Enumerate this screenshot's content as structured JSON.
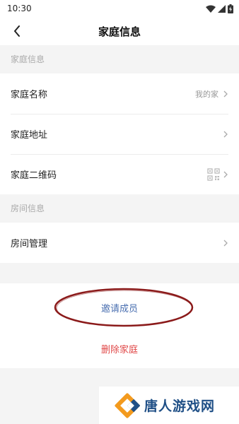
{
  "status_bar": {
    "time": "10:30"
  },
  "header": {
    "title": "家庭信息"
  },
  "sections": [
    {
      "header": "家庭信息",
      "rows": [
        {
          "label": "家庭名称",
          "value": "我的家"
        },
        {
          "label": "家庭地址",
          "value": ""
        },
        {
          "label": "家庭二维码",
          "value": ""
        }
      ]
    },
    {
      "header": "房间信息",
      "rows": [
        {
          "label": "房间管理",
          "value": ""
        }
      ]
    }
  ],
  "actions": {
    "invite": "邀请成员",
    "delete": "删除家庭"
  },
  "watermark": {
    "text": "唐人游戏网"
  },
  "colors": {
    "invite": "#4a6fb0",
    "delete": "#e04848",
    "annotation": "#8b1a1a",
    "watermark_orange": "#f39a1e",
    "watermark_blue": "#1f4f86"
  }
}
